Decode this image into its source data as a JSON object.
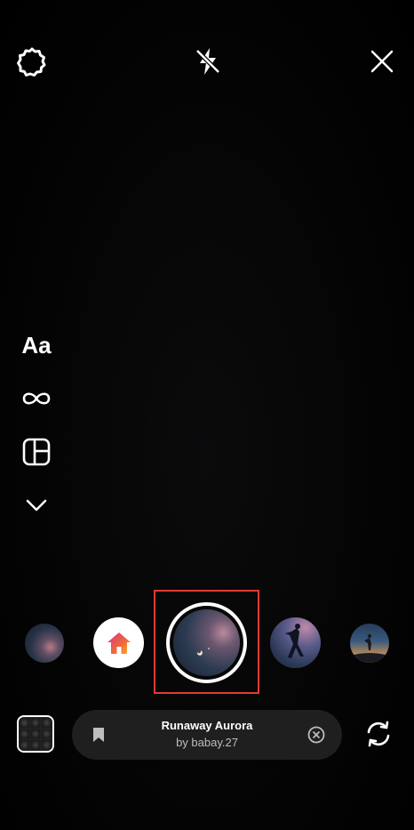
{
  "top_bar": {
    "settings_icon": "settings-icon",
    "flash_icon": "flash-off-icon",
    "close_icon": "close-icon"
  },
  "side_tools": {
    "create_label": "Aa",
    "boomerang_icon": "infinity-icon",
    "layout_icon": "layout-grid-icon",
    "more_icon": "chevron-down-icon"
  },
  "effects": {
    "selected_index": 2,
    "items": [
      "night-sky-effect",
      "home-effect",
      "night-sky-selected",
      "figure-effect",
      "sunset-effect"
    ]
  },
  "music": {
    "title": "Runaway Aurora",
    "artist": "by babay.27"
  },
  "colors": {
    "highlight": "#e53935",
    "pill_bg": "#1f1f1f",
    "text_primary": "#ffffff",
    "text_secondary": "#bdbdbd"
  }
}
